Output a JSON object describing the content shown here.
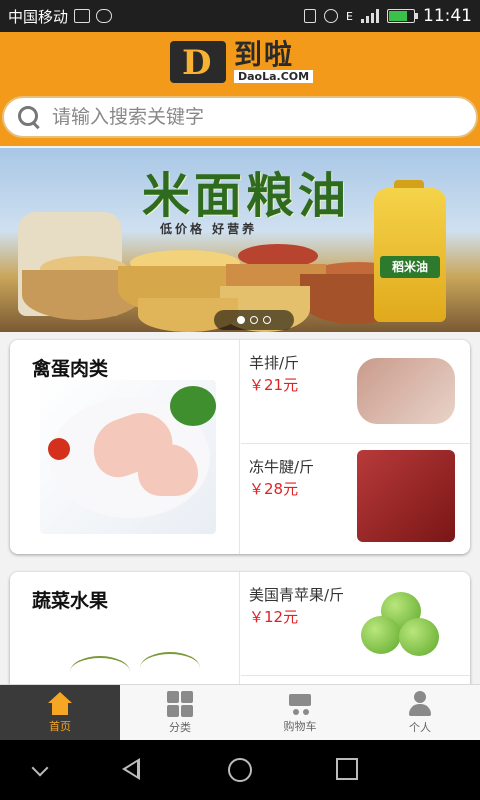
{
  "status_bar": {
    "carrier": "中国移动",
    "time": "11:41",
    "network": "E",
    "battery_level": 0.75
  },
  "header": {
    "logo_cn": "到啦",
    "logo_en": "DaoLa.COM",
    "search_placeholder": "请输入搜索关键字"
  },
  "banner": {
    "title": "米面粮油",
    "subtitle": "低价格 好营养",
    "product_label": "稻米油",
    "slides": 3,
    "active_slide": 1
  },
  "sections": [
    {
      "title": "禽蛋肉类",
      "items": [
        {
          "name": "羊排/斤",
          "price": "￥21元"
        },
        {
          "name": "冻牛腱/斤",
          "price": "￥28元"
        }
      ]
    },
    {
      "title": "蔬菜水果",
      "items": [
        {
          "name": "美国青苹果/斤",
          "price": "￥12元"
        }
      ]
    }
  ],
  "tabs": [
    {
      "label": "首页",
      "icon": "home-icon"
    },
    {
      "label": "分类",
      "icon": "grid-icon"
    },
    {
      "label": "购物车",
      "icon": "cart-icon"
    },
    {
      "label": "个人",
      "icon": "user-icon"
    }
  ],
  "colors": {
    "brand_orange": "#f39a1b",
    "price_red": "#e02222",
    "tab_active_bg": "#3a3a3a",
    "tab_active_fg": "#f5a623"
  }
}
